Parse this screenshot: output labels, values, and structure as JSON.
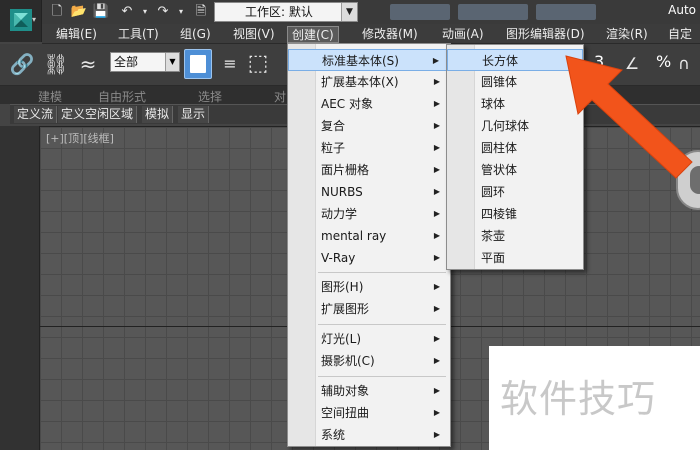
{
  "titlebar": {
    "workspace_label": "工作区: 默认",
    "app_title": "Auto"
  },
  "menubar": {
    "items": [
      "编辑(E)",
      "工具(T)",
      "组(G)",
      "视图(V)",
      "创建(C)",
      "修改器(M)",
      "动画(A)",
      "图形编辑器(D)",
      "渲染(R)",
      "自定"
    ]
  },
  "toolbar": {
    "selection_filter": "全部",
    "snap_label": "3",
    "percent_label": "%"
  },
  "ribbon": {
    "tabs": [
      "建模",
      "自由形式",
      "选择",
      "对"
    ],
    "subtabs": [
      "定义流",
      "定义空闲区域",
      "模拟",
      "显示"
    ]
  },
  "viewport": {
    "label": "[+][顶][线框]"
  },
  "create_menu": {
    "groups": [
      [
        "标准基本体(S)",
        "扩展基本体(X)",
        "AEC 对象",
        "复合",
        "粒子",
        "面片栅格",
        "NURBS",
        "动力学",
        "mental ray",
        "V-Ray"
      ],
      [
        "图形(H)",
        "扩展图形"
      ],
      [
        "灯光(L)",
        "摄影机(C)"
      ],
      [
        "辅助对象",
        "空间扭曲",
        "系统"
      ]
    ]
  },
  "standard_primitives_menu": {
    "items": [
      "长方体",
      "圆锥体",
      "球体",
      "几何球体",
      "圆柱体",
      "管状体",
      "圆环",
      "四棱锥",
      "茶壶",
      "平面"
    ]
  },
  "watermark": {
    "text": "软件技巧"
  },
  "colors": {
    "highlight": "#cbe2fb",
    "arrow": "#f2541b",
    "selection_button": "#4e8fd6"
  }
}
